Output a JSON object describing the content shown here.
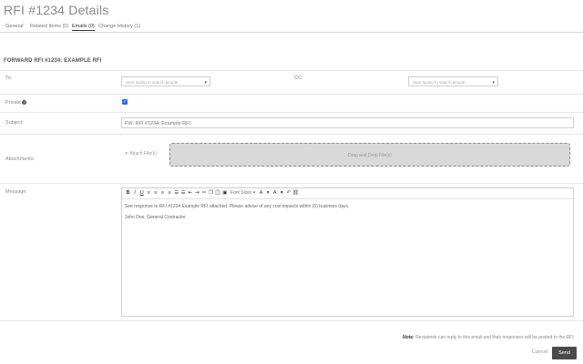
{
  "page": {
    "title": "RFI #1234 Details"
  },
  "tabs": [
    {
      "label": "General"
    },
    {
      "label": "Related Items (0)"
    },
    {
      "label": "Emails (0)"
    },
    {
      "label": "Change History (1)"
    }
  ],
  "form": {
    "section_title": "FORWARD RFI #1234: EXAMPLE RFI",
    "to_label": "To:",
    "to_placeholder": "Start typing to search people...",
    "cc_label": "CC:",
    "cc_placeholder": "Start typing to search people...",
    "private_label": "Private",
    "private_checked": true,
    "subject_label": "Subject:",
    "subject_value": "FW: RFI #1234: Example RFI",
    "attachments_label": "Attachments:",
    "attach_label": "Attach File(s)",
    "dropzone_text": "Drag and Drop File(s)",
    "message_label": "Message:"
  },
  "editor": {
    "toolbar": {
      "bold": "B",
      "italic": "I",
      "underline": "U",
      "font_size": "Font Sizes"
    },
    "body_lines": [
      "See response to RFI #1234 Example RFI attached. Please advise of any cost impacts within (5) business days.",
      "John Doe, General Contractor"
    ]
  },
  "footer": {
    "note_label": "Note:",
    "note_text": "Recipients can reply to this email and their responses will be posted to the RFI.",
    "cancel_label": "Cancel",
    "send_label": "Send"
  },
  "colors": {
    "accent": "#2b6fd6",
    "send_button": "#4a4a4a",
    "dropzone": "#d9d9d9"
  }
}
